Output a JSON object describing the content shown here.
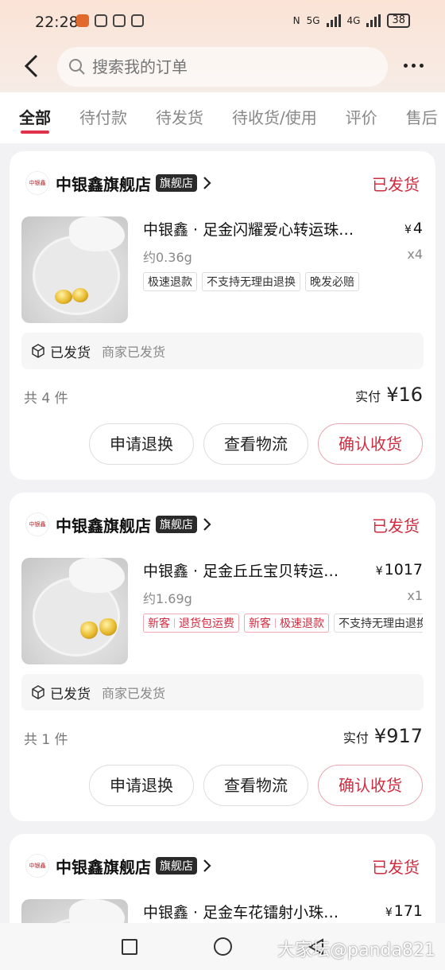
{
  "status_bar": {
    "time": "22:28",
    "network_1": "5G",
    "network_2": "4G",
    "battery": "38"
  },
  "search": {
    "placeholder": "搜索我的订单"
  },
  "tabs": [
    "全部",
    "待付款",
    "待发货",
    "待收货/使用",
    "评价",
    "售后"
  ],
  "orders": [
    {
      "shop_logo": "中银鑫",
      "shop_name": "中银鑫旗舰店",
      "shop_badge": "旗舰店",
      "status": "已发货",
      "title": "中银鑫 · 足金闪耀爱心转运珠…",
      "currency": "¥",
      "price": "4",
      "spec": "约0.36g",
      "qty": "x4",
      "tags": [
        "极速退款",
        "不支持无理由退换",
        "晚发必赔"
      ],
      "ship_status": "已发货",
      "ship_desc": "商家已发货",
      "count": "共 4 件",
      "paid_label": "实付",
      "paid_amount": "¥16",
      "buttons": [
        "申请退换",
        "查看物流",
        "确认收货"
      ]
    },
    {
      "shop_logo": "中银鑫",
      "shop_name": "中银鑫旗舰店",
      "shop_badge": "旗舰店",
      "status": "已发货",
      "title": "中银鑫 · 足金丘丘宝贝转运…",
      "currency": "¥",
      "price": "1017",
      "spec": "约1.69g",
      "qty": "x1",
      "red_tags": [
        {
          "a": "新客",
          "b": "退货包运费"
        },
        {
          "a": "新客",
          "b": "极速退款"
        }
      ],
      "tags": [
        "不支持无理由退换"
      ],
      "ship_status": "已发货",
      "ship_desc": "商家已发货",
      "count": "共 1 件",
      "paid_label": "实付",
      "paid_amount": "¥917",
      "buttons": [
        "申请退换",
        "查看物流",
        "确认收货"
      ]
    },
    {
      "shop_logo": "中银鑫",
      "shop_name": "中银鑫旗舰店",
      "shop_badge": "旗舰店",
      "status": "已发货",
      "title": "中银鑫 · 足金车花镭射小珠…",
      "currency": "¥",
      "price": "171"
    }
  ],
  "watermark": "大家坛@panda821",
  "colors": {
    "accent": "#d22b40",
    "tab_indicator": "#e0334a",
    "header_bg": "#fbe3d6"
  }
}
